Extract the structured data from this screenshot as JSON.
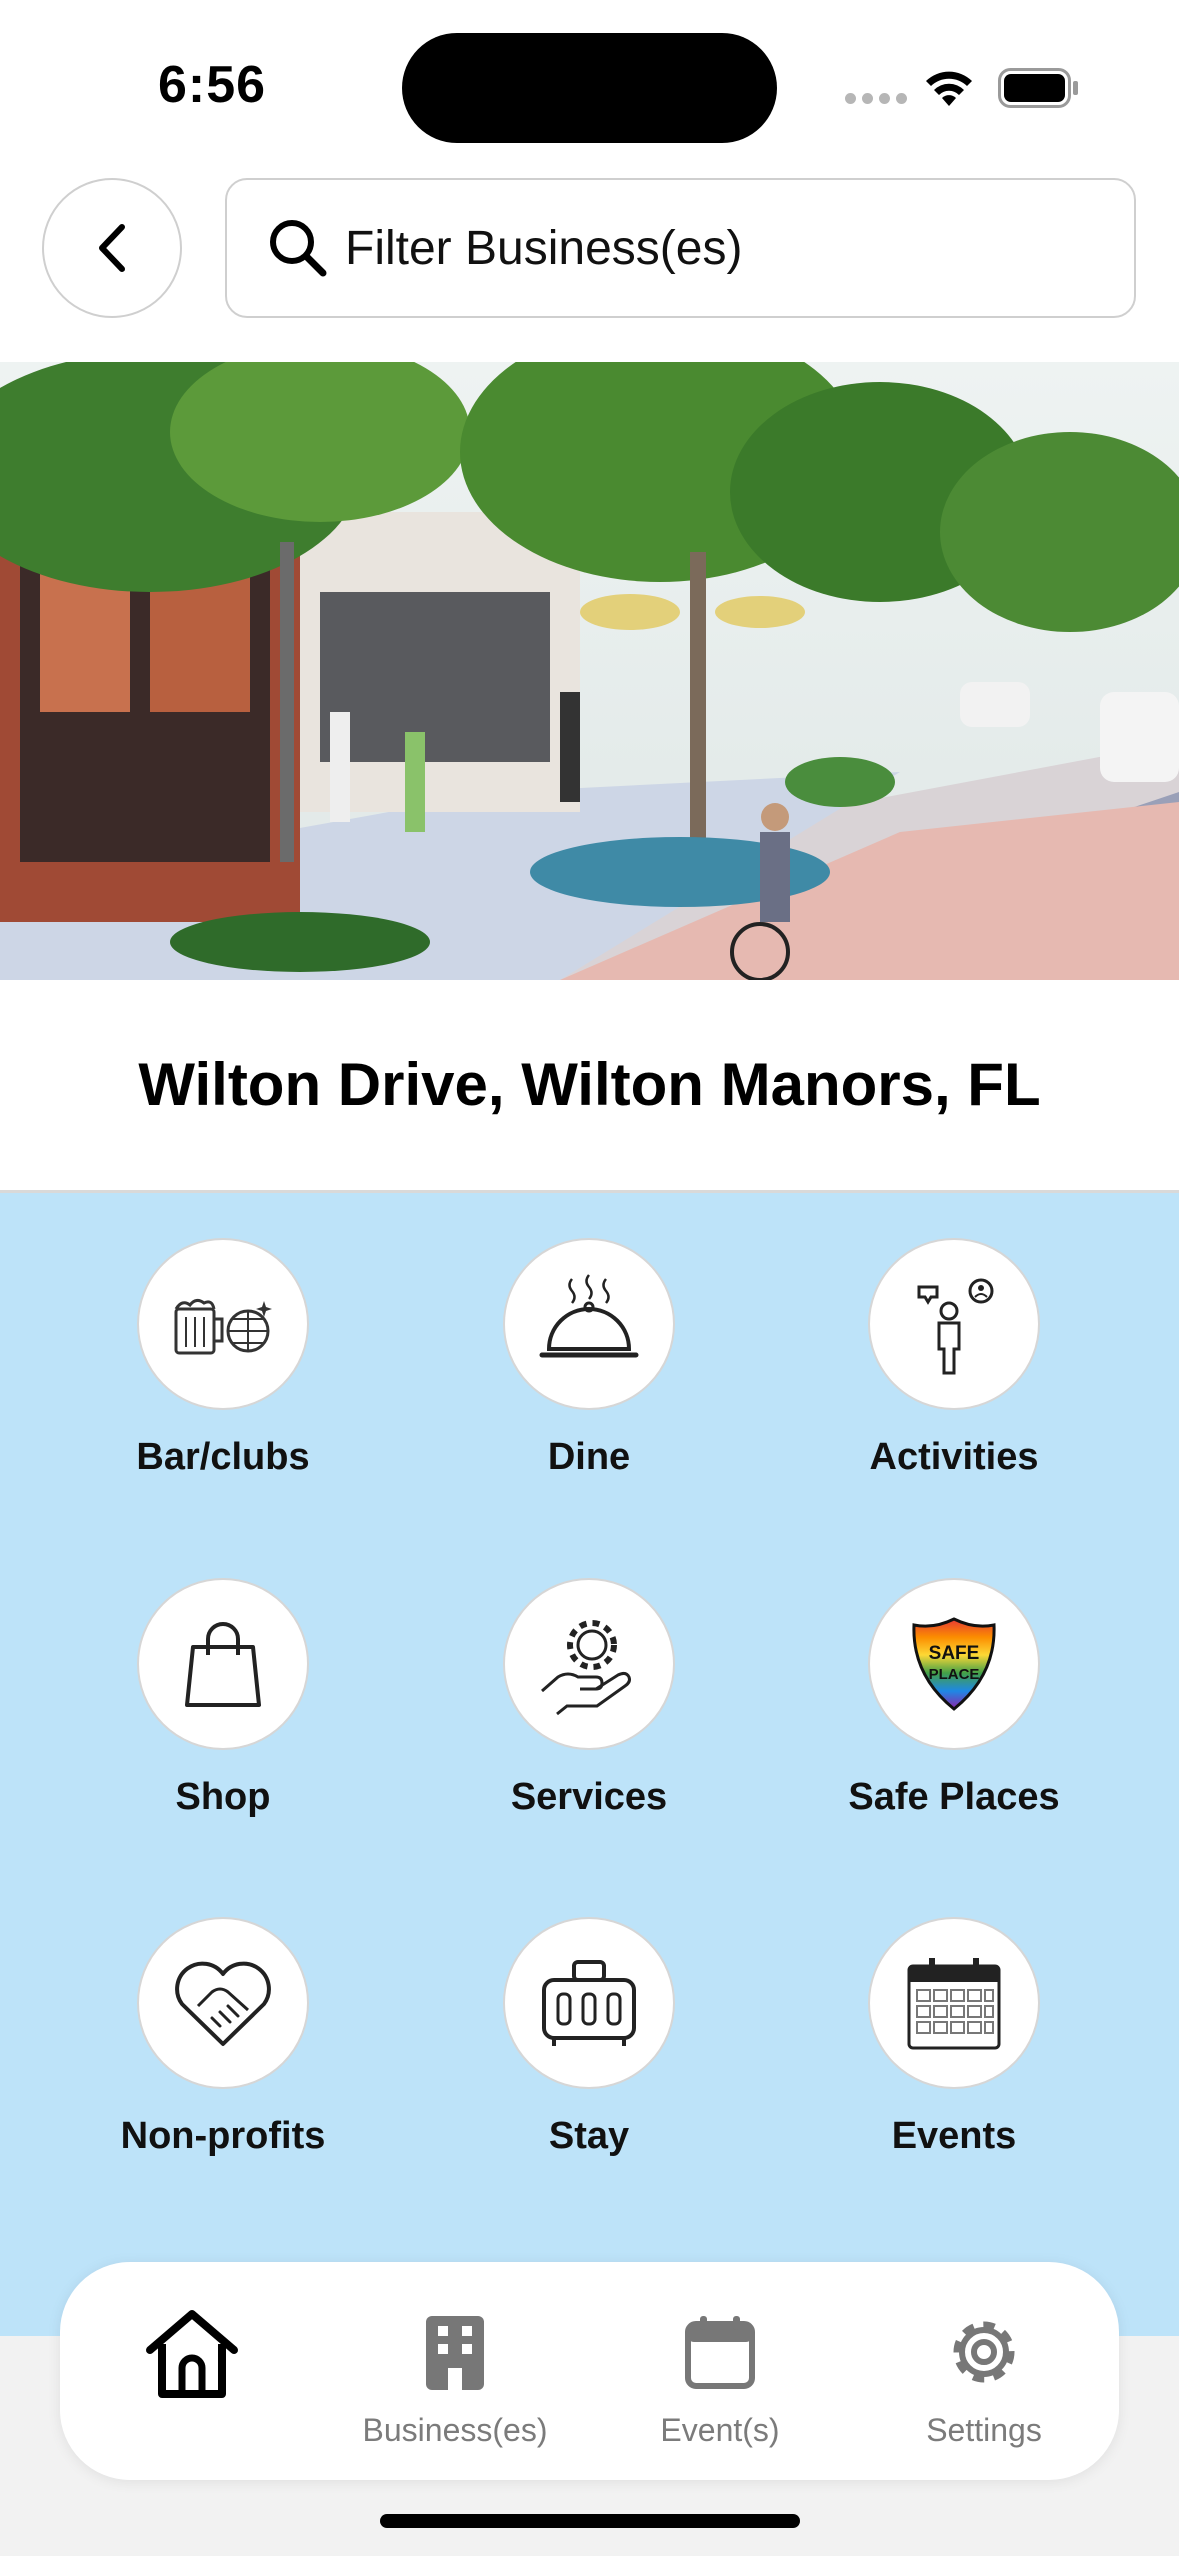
{
  "status_bar": {
    "time": "6:56",
    "icons": [
      "signal-icon",
      "wifi-icon",
      "battery-icon"
    ]
  },
  "header": {
    "back_icon": "chevron-left-icon",
    "search": {
      "icon": "search-icon",
      "placeholder": "Filter Business(es)",
      "value": ""
    }
  },
  "hero": {
    "image": "street-illustration"
  },
  "location": {
    "title": "Wilton Drive, Wilton Manors, FL"
  },
  "categories": [
    {
      "label": "Bar/clubs",
      "icon": "beer-disco-ball-icon"
    },
    {
      "label": "Dine",
      "icon": "food-cloche-icon"
    },
    {
      "label": "Activities",
      "icon": "person-chat-icon"
    },
    {
      "label": "Shop",
      "icon": "shopping-bag-icon"
    },
    {
      "label": "Services",
      "icon": "gear-hand-icon"
    },
    {
      "label": "Safe Places",
      "icon": "safe-place-shield-icon",
      "badge_text": "SAFE PLACE"
    },
    {
      "label": "Non-profits",
      "icon": "heart-handshake-icon"
    },
    {
      "label": "Stay",
      "icon": "luggage-icon"
    },
    {
      "label": "Events",
      "icon": "calendar-icon"
    }
  ],
  "tab_bar": {
    "tabs": [
      {
        "label": "",
        "icon": "home-icon",
        "active": true
      },
      {
        "label": "Business(es)",
        "icon": "building-icon",
        "active": false
      },
      {
        "label": "Event(s)",
        "icon": "calendar-icon",
        "active": false
      },
      {
        "label": "Settings",
        "icon": "gear-icon",
        "active": false
      }
    ]
  },
  "colors": {
    "category_background": "#bde3f9",
    "tab_inactive": "#7b7b7b",
    "tab_active": "#000000"
  }
}
